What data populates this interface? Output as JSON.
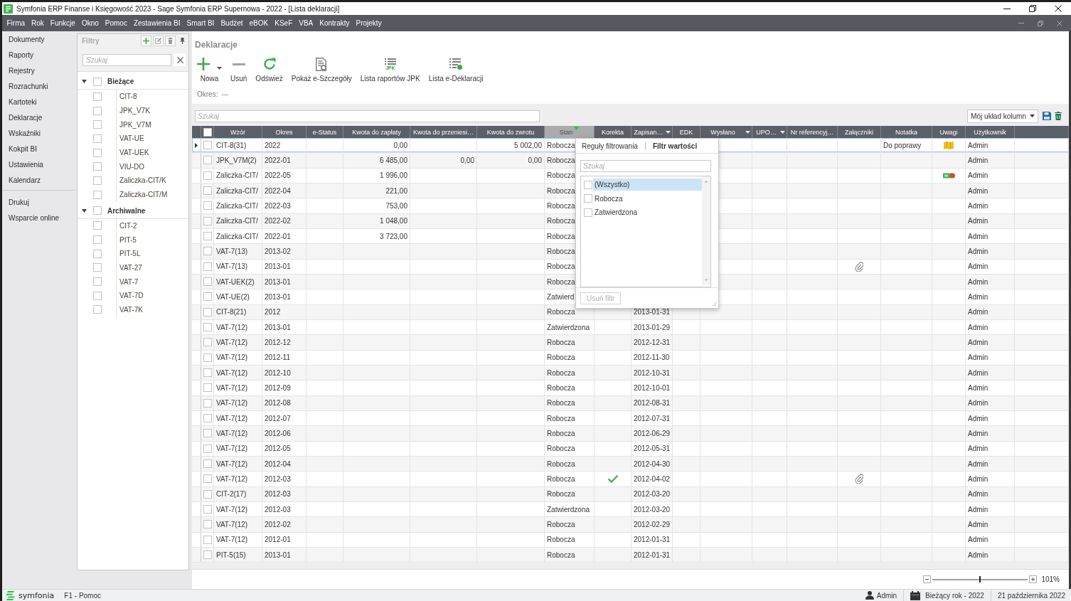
{
  "window": {
    "title": "Symfonia ERP Finanse i Księgowość 2023 - Sage Symfonia ERP Supernowa - 2022 - [Lista deklaracji]"
  },
  "menu": [
    "Firma",
    "Rok",
    "Funkcje",
    "Okno",
    "Pomoc",
    "Zestawienia BI",
    "Smart BI",
    "Budżet",
    "eBOK",
    "KSeF",
    "VBA",
    "Kontrakty",
    "Projekty"
  ],
  "nav": {
    "items": [
      "Dokumenty",
      "Raporty",
      "Rejestry",
      "Rozrachunki",
      "Kartoteki",
      "Deklaracje",
      "Wskaźniki",
      "Kokpit BI",
      "Ustawienia",
      "Kalendarz"
    ],
    "bottom_items": [
      "Drukuj",
      "Wsparcie online"
    ]
  },
  "filters": {
    "title": "Filtry",
    "search": {
      "placeholder": "Szukaj"
    },
    "groups": [
      {
        "label": "Bieżące",
        "expanded": true,
        "checked": false,
        "children": [
          {
            "label": "CIT-8",
            "checked": false
          },
          {
            "label": "JPK_V7K",
            "checked": false
          },
          {
            "label": "JPK_V7M",
            "checked": false
          },
          {
            "label": "VAT-UE",
            "checked": false
          },
          {
            "label": "VAT-UEK",
            "checked": false
          },
          {
            "label": "VIU-DO",
            "checked": false
          },
          {
            "label": "Zaliczka-CIT/K",
            "checked": false
          },
          {
            "label": "Zaliczka-CIT/M",
            "checked": false
          }
        ]
      },
      {
        "label": "Archiwalne",
        "expanded": true,
        "checked": false,
        "children": [
          {
            "label": "CIT-2",
            "checked": false
          },
          {
            "label": "PIT-5",
            "checked": false
          },
          {
            "label": "PIT-5L",
            "checked": false
          },
          {
            "label": "VAT-27",
            "checked": false
          },
          {
            "label": "VAT-7",
            "checked": false
          },
          {
            "label": "VAT-7D",
            "checked": false
          },
          {
            "label": "VAT-7K",
            "checked": false
          }
        ]
      }
    ]
  },
  "page": {
    "title": "Deklaracje",
    "toolbar": [
      {
        "label": "Nowa",
        "kind": "new",
        "dropdown": true
      },
      {
        "label": "Usuń",
        "kind": "delete",
        "dropdown": false
      },
      {
        "label": "Odśwież",
        "kind": "refresh",
        "dropdown": false
      },
      {
        "label": "Pokaż e-Szczegóły",
        "kind": "details",
        "dropdown": false
      },
      {
        "label": "Lista raportów JPK",
        "kind": "jpk",
        "badge": "JPK",
        "dropdown": false
      },
      {
        "label": "Lista e-Deklaracji",
        "kind": "edecl",
        "dropdown": false
      }
    ],
    "period": {
      "label": "Okres:",
      "value": "---"
    }
  },
  "grid": {
    "search": {
      "placeholder": "Szukaj"
    },
    "layout": {
      "value": "Mój układ kolumn"
    },
    "select_all": {
      "checked": false
    },
    "columns": [
      {
        "label": "Wzór",
        "dropdown": false,
        "filtered": false
      },
      {
        "label": "Okres",
        "dropdown": false,
        "filtered": false
      },
      {
        "label": "e-Status",
        "dropdown": false,
        "filtered": false
      },
      {
        "label": "Kwota do zapłaty",
        "dropdown": false,
        "filtered": false
      },
      {
        "label": "Kwota do przeniesi…",
        "dropdown": false,
        "filtered": false
      },
      {
        "label": "Kwota do zwrotu",
        "dropdown": false,
        "filtered": false
      },
      {
        "label": "Stan",
        "dropdown": false,
        "filtered": true
      },
      {
        "label": "Korekta",
        "dropdown": false,
        "filtered": false
      },
      {
        "label": "Zapisan…",
        "dropdown": true,
        "filtered": false
      },
      {
        "label": "EDK",
        "dropdown": false,
        "filtered": false
      },
      {
        "label": "Wysłano",
        "dropdown": true,
        "filtered": false
      },
      {
        "label": "UPO…",
        "dropdown": true,
        "filtered": false
      },
      {
        "label": "Nr referencyj…",
        "dropdown": false,
        "filtered": false
      },
      {
        "label": "Załączniki",
        "dropdown": false,
        "filtered": false
      },
      {
        "label": "Notatka",
        "dropdown": false,
        "filtered": false
      },
      {
        "label": "Uwagi",
        "dropdown": false,
        "filtered": false
      },
      {
        "label": "Użytkownik",
        "dropdown": false,
        "filtered": false
      }
    ],
    "rows": [
      {
        "wzor": "CIT-8(31)",
        "okres": "2022",
        "kwota_do_zaplaty": "0,00",
        "kwota_do_zwrotu": "5 002,00",
        "stan": "Robocza",
        "zalaczniki": false,
        "notatka": "Do poprawy",
        "uwagi": {
          "kind": "note"
        },
        "uzytkownik": "Admin",
        "checked": false,
        "selected": true
      },
      {
        "wzor": "JPK_V7M(2)",
        "okres": "2022-01",
        "kwota_do_zaplaty": "6 485,00",
        "kwota_do_przeniesienia": "0,00",
        "kwota_do_zwrotu": "0,00",
        "stan": "Robocza",
        "zalaczniki": false,
        "uzytkownik": "Admin",
        "checked": false,
        "selected": false
      },
      {
        "wzor": "Zaliczka-CIT/",
        "okres": "2022-05",
        "kwota_do_zaplaty": "1 996,00",
        "stan": "Robocza",
        "zalaczniki": false,
        "uwagi": {
          "kind": "card-error"
        },
        "uzytkownik": "Admin",
        "checked": false,
        "selected": false
      },
      {
        "wzor": "Zaliczka-CIT/",
        "okres": "2022-04",
        "kwota_do_zaplaty": "221,00",
        "stan": "Robocza",
        "zalaczniki": false,
        "uzytkownik": "Admin",
        "checked": false,
        "selected": false
      },
      {
        "wzor": "Zaliczka-CIT/",
        "okres": "2022-03",
        "kwota_do_zaplaty": "753,00",
        "stan": "Robocza",
        "zalaczniki": false,
        "uzytkownik": "Admin",
        "checked": false,
        "selected": false
      },
      {
        "wzor": "Zaliczka-CIT/",
        "okres": "2022-02",
        "kwota_do_zaplaty": "1 048,00",
        "stan": "Robocza",
        "zalaczniki": false,
        "uzytkownik": "Admin",
        "checked": false,
        "selected": false
      },
      {
        "wzor": "Zaliczka-CIT/",
        "okres": "2022-01",
        "kwota_do_zaplaty": "3 723,00",
        "stan": "Robocza",
        "zalaczniki": false,
        "uzytkownik": "Admin",
        "checked": false,
        "selected": false
      },
      {
        "wzor": "VAT-7(13)",
        "okres": "2013-02",
        "stan": "Robocza",
        "zalaczniki": false,
        "uzytkownik": "Admin",
        "checked": false,
        "selected": false
      },
      {
        "wzor": "VAT-7(13)",
        "okres": "2013-01",
        "stan": "Robocza",
        "zalaczniki": true,
        "uzytkownik": "Admin",
        "checked": false,
        "selected": false
      },
      {
        "wzor": "VAT-UEK(2)",
        "okres": "2013-01",
        "stan": "Robocza",
        "zalaczniki": false,
        "uzytkownik": "Admin",
        "checked": false,
        "selected": false
      },
      {
        "wzor": "VAT-UE(2)",
        "okres": "2013-01",
        "stan": "Zatwierd",
        "zalaczniki": false,
        "uzytkownik": "Admin",
        "checked": false,
        "selected": false
      },
      {
        "wzor": "CIT-8(21)",
        "okres": "2012",
        "stan": "Robocza",
        "korekta": false,
        "zapisano": "2013-01-31",
        "zalaczniki": false,
        "uzytkownik": "Admin",
        "checked": false,
        "selected": false
      },
      {
        "wzor": "VAT-7(12)",
        "okres": "2013-01",
        "stan": "Zatwierdzona",
        "korekta": false,
        "zapisano": "2013-01-29",
        "zalaczniki": false,
        "uzytkownik": "Admin",
        "checked": false,
        "selected": false
      },
      {
        "wzor": "VAT-7(12)",
        "okres": "2012-12",
        "stan": "Robocza",
        "korekta": false,
        "zapisano": "2012-12-31",
        "zalaczniki": false,
        "uzytkownik": "Admin",
        "checked": false,
        "selected": false
      },
      {
        "wzor": "VAT-7(12)",
        "okres": "2012-11",
        "stan": "Robocza",
        "korekta": false,
        "zapisano": "2012-11-30",
        "zalaczniki": false,
        "uzytkownik": "Admin",
        "checked": false,
        "selected": false
      },
      {
        "wzor": "VAT-7(12)",
        "okres": "2012-10",
        "stan": "Robocza",
        "korekta": false,
        "zapisano": "2012-10-31",
        "zalaczniki": false,
        "uzytkownik": "Admin",
        "checked": false,
        "selected": false
      },
      {
        "wzor": "VAT-7(12)",
        "okres": "2012-09",
        "stan": "Robocza",
        "korekta": false,
        "zapisano": "2012-10-01",
        "zalaczniki": false,
        "uzytkownik": "Admin",
        "checked": false,
        "selected": false
      },
      {
        "wzor": "VAT-7(12)",
        "okres": "2012-08",
        "stan": "Robocza",
        "korekta": false,
        "zapisano": "2012-08-31",
        "zalaczniki": false,
        "uzytkownik": "Admin",
        "checked": false,
        "selected": false
      },
      {
        "wzor": "VAT-7(12)",
        "okres": "2012-07",
        "stan": "Robocza",
        "korekta": false,
        "zapisano": "2012-07-31",
        "zalaczniki": false,
        "uzytkownik": "Admin",
        "checked": false,
        "selected": false
      },
      {
        "wzor": "VAT-7(12)",
        "okres": "2012-06",
        "stan": "Robocza",
        "korekta": false,
        "zapisano": "2012-06-29",
        "zalaczniki": false,
        "uzytkownik": "Admin",
        "checked": false,
        "selected": false
      },
      {
        "wzor": "VAT-7(12)",
        "okres": "2012-05",
        "stan": "Robocza",
        "korekta": false,
        "zapisano": "2012-05-31",
        "zalaczniki": false,
        "uzytkownik": "Admin",
        "checked": false,
        "selected": false
      },
      {
        "wzor": "VAT-7(12)",
        "okres": "2012-04",
        "stan": "Robocza",
        "korekta": false,
        "zapisano": "2012-04-30",
        "zalaczniki": false,
        "uzytkownik": "Admin",
        "checked": false,
        "selected": false
      },
      {
        "wzor": "VAT-7(12)",
        "okres": "2012-03",
        "stan": "Robocza",
        "korekta": true,
        "zapisano": "2012-04-02",
        "zalaczniki": true,
        "uzytkownik": "Admin",
        "checked": false,
        "selected": false
      },
      {
        "wzor": "CIT-2(17)",
        "okres": "2012-03",
        "stan": "Robocza",
        "korekta": false,
        "zapisano": "2012-03-20",
        "zalaczniki": false,
        "uzytkownik": "Admin",
        "checked": false,
        "selected": false
      },
      {
        "wzor": "VAT-7(12)",
        "okres": "2012-03",
        "stan": "Zatwierdzona",
        "korekta": false,
        "zapisano": "2012-03-20",
        "zalaczniki": false,
        "uzytkownik": "Admin",
        "checked": false,
        "selected": false
      },
      {
        "wzor": "VAT-7(12)",
        "okres": "2012-02",
        "stan": "Robocza",
        "korekta": false,
        "zapisano": "2012-02-29",
        "zalaczniki": false,
        "uzytkownik": "Admin",
        "checked": false,
        "selected": false
      },
      {
        "wzor": "VAT-7(12)",
        "okres": "2012-01",
        "stan": "Robocza",
        "korekta": false,
        "zapisano": "2012-01-31",
        "zalaczniki": false,
        "uzytkownik": "Admin",
        "checked": false,
        "selected": false
      },
      {
        "wzor": "PIT-5(15)",
        "okres": "2013-01",
        "stan": "Robocza",
        "korekta": false,
        "zapisano": "2012-01-31",
        "zalaczniki": false,
        "uzytkownik": "Admin",
        "checked": false,
        "selected": false
      }
    ]
  },
  "filter_popup": {
    "tabs": [
      {
        "label": "Reguły filtrowania",
        "selected": false
      },
      {
        "label": "Filtr wartości",
        "selected": true
      }
    ],
    "search": {
      "placeholder": "Szukaj"
    },
    "values": [
      {
        "label": "(Wszystko)",
        "checked": false,
        "selected": true
      },
      {
        "label": "Robocza",
        "checked": false,
        "selected": false
      },
      {
        "label": "Zatwierdzona",
        "checked": false,
        "selected": false
      }
    ],
    "button": {
      "label": "Usuń filtr",
      "disabled": true
    }
  },
  "zoom": {
    "level": 0.5,
    "reading": "101%"
  },
  "status_bar": {
    "logo": "symfonia",
    "help": "F1 - Pomoc",
    "user": "Admin",
    "period": "Bieżący rok - 2022",
    "date": "21 października 2022"
  }
}
